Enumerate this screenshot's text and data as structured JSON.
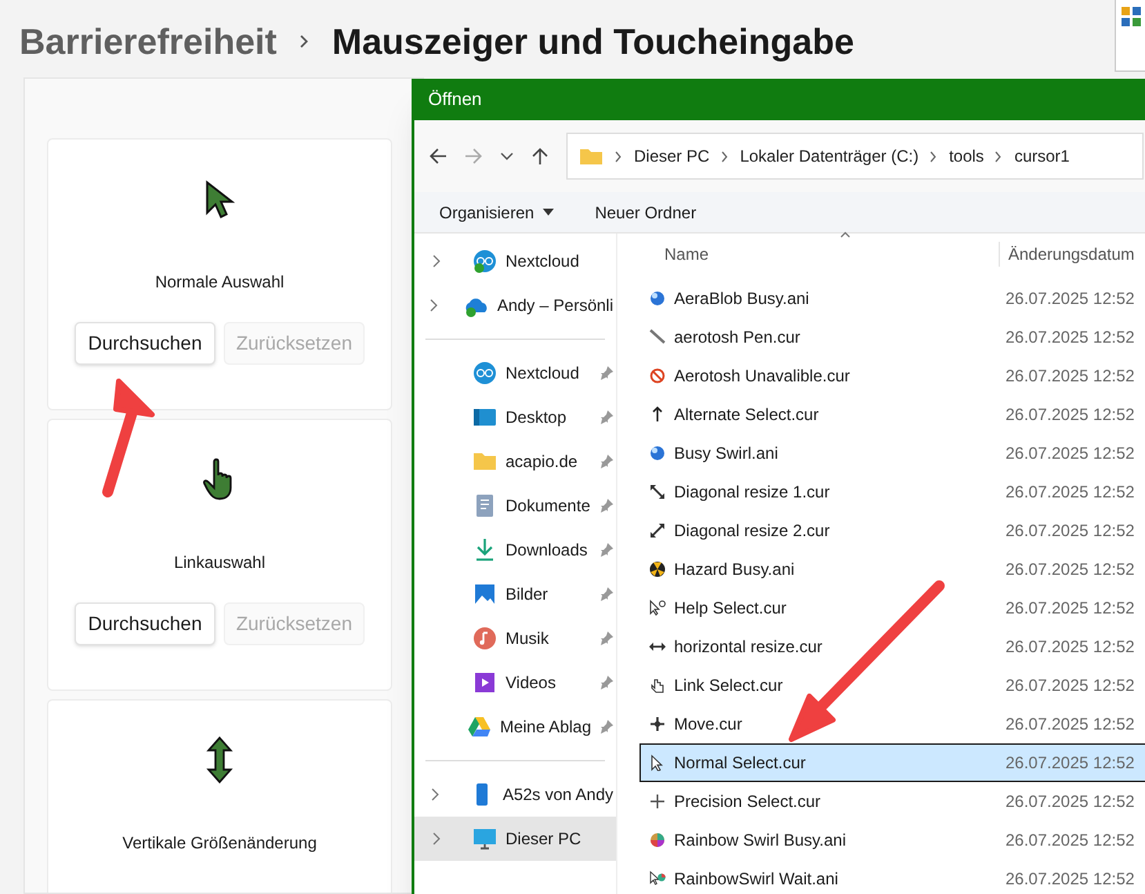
{
  "settings": {
    "breadcrumb": [
      {
        "label": "Barrierefreiheit",
        "current": false
      },
      {
        "label": "Mauszeiger und Toucheingabe",
        "current": true
      }
    ],
    "cards": [
      {
        "kind": "arrow",
        "label": "Normale Auswahl",
        "buttons": [
          {
            "label": "Durchsuchen",
            "disabled": false
          },
          {
            "label": "Zurücksetzen",
            "disabled": true
          }
        ]
      },
      {
        "kind": "hand",
        "label": "Linkauswahl",
        "buttons": [
          {
            "label": "Durchsuchen",
            "disabled": false
          },
          {
            "label": "Zurücksetzen",
            "disabled": true
          }
        ]
      },
      {
        "kind": "vresize",
        "label": "Vertikale Größenänderung"
      }
    ]
  },
  "dialog": {
    "title": "Öffnen",
    "address": [
      "Dieser PC",
      "Lokaler Datenträger (C:)",
      "tools",
      "cursor1"
    ],
    "commands": [
      {
        "label": "Organisieren",
        "dropdown": true
      },
      {
        "label": "Neuer Ordner",
        "dropdown": false
      }
    ],
    "sidebar": {
      "groups": [
        [
          {
            "label": "Nextcloud",
            "kind": "nextcloud-sync",
            "expandable": true,
            "pinned": false,
            "selected": false
          },
          {
            "label": "Andy – Persönli",
            "kind": "onedrive",
            "expandable": true,
            "pinned": false,
            "selected": false
          }
        ],
        [
          {
            "label": "Nextcloud",
            "kind": "nextcloud",
            "expandable": false,
            "pinned": true,
            "selected": false
          },
          {
            "label": "Desktop",
            "kind": "desktop",
            "expandable": false,
            "pinned": true,
            "selected": false
          },
          {
            "label": "acapio.de",
            "kind": "folder",
            "expandable": false,
            "pinned": true,
            "selected": false
          },
          {
            "label": "Dokumente",
            "kind": "documents",
            "expandable": false,
            "pinned": true,
            "selected": false
          },
          {
            "label": "Downloads",
            "kind": "downloads",
            "expandable": false,
            "pinned": true,
            "selected": false
          },
          {
            "label": "Bilder",
            "kind": "pictures",
            "expandable": false,
            "pinned": true,
            "selected": false
          },
          {
            "label": "Musik",
            "kind": "music",
            "expandable": false,
            "pinned": true,
            "selected": false
          },
          {
            "label": "Videos",
            "kind": "videos",
            "expandable": false,
            "pinned": true,
            "selected": false
          },
          {
            "label": "Meine Ablag",
            "kind": "drive",
            "expandable": false,
            "pinned": true,
            "selected": false
          }
        ],
        [
          {
            "label": "A52s von Andy",
            "kind": "phone",
            "expandable": true,
            "pinned": false,
            "selected": false
          },
          {
            "label": "Dieser PC",
            "kind": "pc",
            "expandable": true,
            "pinned": false,
            "selected": true
          }
        ]
      ]
    },
    "table": {
      "columns": [
        "Name",
        "Änderungsdatum"
      ],
      "rows": [
        {
          "name": "AeraBlob Busy.ani",
          "date": "26.07.2025 12:52",
          "kind": "blob",
          "selected": false
        },
        {
          "name": "aerotosh Pen.cur",
          "date": "26.07.2025 12:52",
          "kind": "pen",
          "selected": false
        },
        {
          "name": "Aerotosh Unavalible.cur",
          "date": "26.07.2025 12:52",
          "kind": "unavailable",
          "selected": false
        },
        {
          "name": "Alternate Select.cur",
          "date": "26.07.2025 12:52",
          "kind": "uparrow",
          "selected": false
        },
        {
          "name": "Busy Swirl.ani",
          "date": "26.07.2025 12:52",
          "kind": "blob",
          "selected": false
        },
        {
          "name": "Diagonal resize 1.cur",
          "date": "26.07.2025 12:52",
          "kind": "diag1",
          "selected": false
        },
        {
          "name": "Diagonal resize 2.cur",
          "date": "26.07.2025 12:52",
          "kind": "diag2",
          "selected": false
        },
        {
          "name": "Hazard Busy.ani",
          "date": "26.07.2025 12:52",
          "kind": "hazard",
          "selected": false
        },
        {
          "name": "Help Select.cur",
          "date": "26.07.2025 12:52",
          "kind": "help",
          "selected": false
        },
        {
          "name": "horizontal resize.cur",
          "date": "26.07.2025 12:52",
          "kind": "hresize",
          "selected": false
        },
        {
          "name": "Link Select.cur",
          "date": "26.07.2025 12:52",
          "kind": "hand",
          "selected": false
        },
        {
          "name": "Move.cur",
          "date": "26.07.2025 12:52",
          "kind": "move",
          "selected": false
        },
        {
          "name": "Normal Select.cur",
          "date": "26.07.2025 12:52",
          "kind": "pointer",
          "selected": true
        },
        {
          "name": "Precision Select.cur",
          "date": "26.07.2025 12:52",
          "kind": "cross",
          "selected": false
        },
        {
          "name": "Rainbow Swirl Busy.ani",
          "date": "26.07.2025 12:52",
          "kind": "rainbow",
          "selected": false
        },
        {
          "name": "RainbowSwirl Wait.ani",
          "date": "26.07.2025 12:52",
          "kind": "rainbowwait",
          "selected": false
        }
      ]
    }
  }
}
